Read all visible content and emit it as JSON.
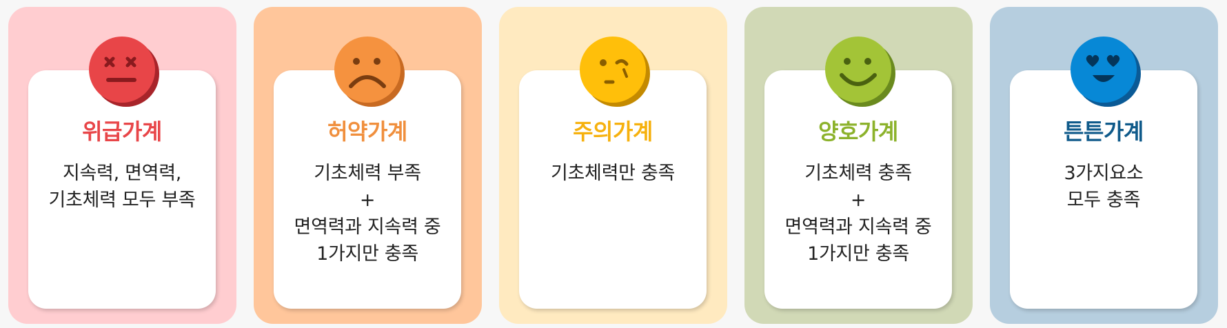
{
  "cards": [
    {
      "title": "위급가계",
      "desc": "지속력, 면역력,\n기초체력 모두 부족",
      "bg": "#ffcdd0",
      "color": "#e84548",
      "face": "dizzy-face-icon"
    },
    {
      "title": "허약가계",
      "desc": "기초체력 부족\n+\n면역력과 지속력 중\n1가지만 충족",
      "bg": "#ffc69b",
      "color": "#f08f3d",
      "face": "sad-face-icon"
    },
    {
      "title": "주의가계",
      "desc": "기초체력만 충족",
      "bg": "#ffeac0",
      "color": "#f6b10e",
      "face": "worried-face-icon"
    },
    {
      "title": "양호가계",
      "desc": "기초체력 충족\n+\n면역력과 지속력 중\n1가지만 충족",
      "bg": "#d1d9b6",
      "color": "#8cb22b",
      "face": "smile-face-icon"
    },
    {
      "title": "튼튼가계",
      "desc": "3가지요소\n모두 충족",
      "bg": "#b6cedf",
      "color": "#0f5a8a",
      "face": "heart-eyes-face-icon"
    }
  ]
}
